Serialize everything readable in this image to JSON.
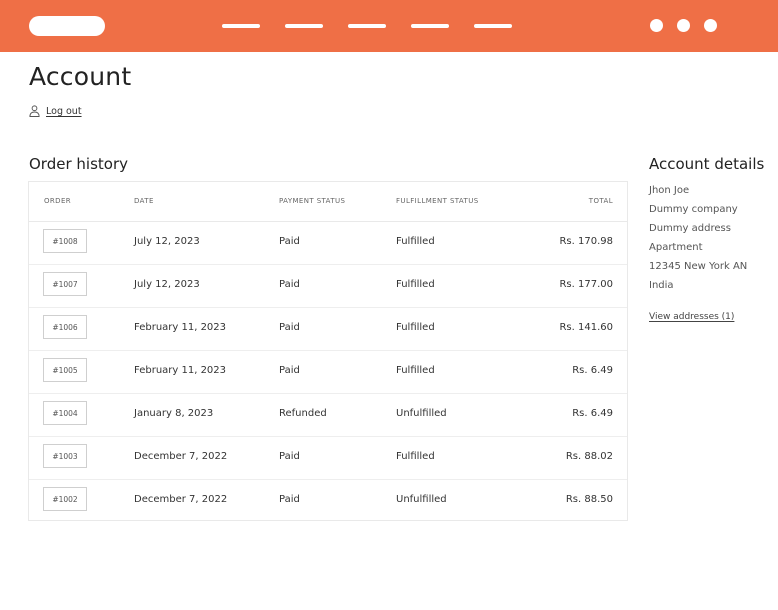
{
  "colors": {
    "header_bg": "#ef6f46",
    "text": "#333333",
    "border": "#e9e9e9"
  },
  "header": {
    "logo_icon": "logo-placeholder",
    "nav_items_count_icon": "nav-placeholder-bars",
    "menu_icon": "three-dots-icon"
  },
  "page": {
    "title": "Account",
    "logout_label": "Log out",
    "logout_icon": "user-icon"
  },
  "orders": {
    "title": "Order history",
    "columns": {
      "order": "ORDER",
      "date": "DATE",
      "payment": "PAYMENT STATUS",
      "fulfillment": "FULFILLMENT STATUS",
      "total": "TOTAL"
    },
    "rows": [
      {
        "order": "#1008",
        "date": "July 12, 2023",
        "payment": "Paid",
        "fulfillment": "Fulfilled",
        "total": "Rs. 170.98"
      },
      {
        "order": "#1007",
        "date": "July 12, 2023",
        "payment": "Paid",
        "fulfillment": "Fulfilled",
        "total": "Rs. 177.00"
      },
      {
        "order": "#1006",
        "date": "February 11, 2023",
        "payment": "Paid",
        "fulfillment": "Fulfilled",
        "total": "Rs. 141.60"
      },
      {
        "order": "#1005",
        "date": "February 11, 2023",
        "payment": "Paid",
        "fulfillment": "Fulfilled",
        "total": "Rs. 6.49"
      },
      {
        "order": "#1004",
        "date": "January 8, 2023",
        "payment": "Refunded",
        "fulfillment": "Unfulfilled",
        "total": "Rs. 6.49"
      },
      {
        "order": "#1003",
        "date": "December 7, 2022",
        "payment": "Paid",
        "fulfillment": "Fulfilled",
        "total": "Rs. 88.02"
      },
      {
        "order": "#1002",
        "date": "December 7, 2022",
        "payment": "Paid",
        "fulfillment": "Unfulfilled",
        "total": "Rs. 88.50"
      }
    ]
  },
  "account_details": {
    "title": "Account details",
    "lines": [
      "Jhon Joe",
      "Dummy company",
      "Dummy address",
      "Apartment",
      "12345 New York AN",
      "India"
    ],
    "view_addresses_label": "View addresses (1)"
  }
}
